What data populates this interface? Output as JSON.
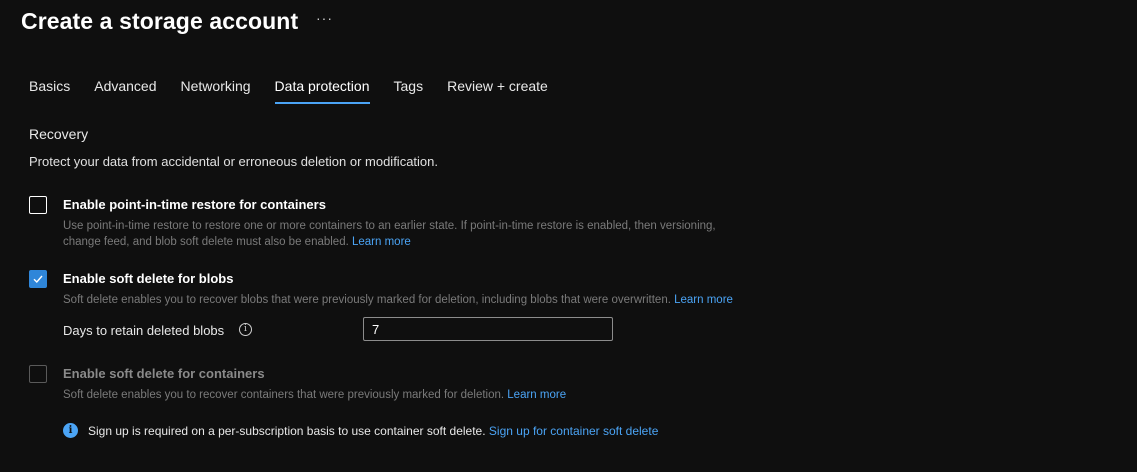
{
  "header": {
    "title": "Create a storage account",
    "more_label": "···"
  },
  "tabs": [
    {
      "label": "Basics"
    },
    {
      "label": "Advanced"
    },
    {
      "label": "Networking"
    },
    {
      "label": "Data protection",
      "active": true
    },
    {
      "label": "Tags"
    },
    {
      "label": "Review + create"
    }
  ],
  "recovery": {
    "title": "Recovery",
    "description": "Protect your data from accidental or erroneous deletion or modification.",
    "options": [
      {
        "label": "Enable point-in-time restore for containers",
        "help_line1": "Use point-in-time restore to restore one or more containers to an earlier state. If point-in-time restore is enabled, then versioning,",
        "help_line2": "change feed, and blob soft delete must also be enabled.",
        "link": "Learn more",
        "checked": false,
        "disabled": false
      },
      {
        "label": "Enable soft delete for blobs",
        "help": "Soft delete enables you to recover blobs that were previously marked for deletion, including blobs that were overwritten.",
        "link": "Learn more",
        "checked": true,
        "disabled": false
      },
      {
        "label": "Enable soft delete for containers",
        "help": "Soft delete enables you to recover containers that were previously marked for deletion.",
        "link": "Learn more",
        "checked": false,
        "disabled": true
      }
    ],
    "retain_days": {
      "label": "Days to retain deleted blobs",
      "value": "7"
    },
    "info_banner": {
      "text": "Sign up is required on a per-subscription basis to use container soft delete.",
      "link": "Sign up for container soft delete"
    }
  },
  "colors": {
    "background": "#0f0f0f",
    "accent": "#4ba4f5",
    "checkbox_checked": "#2f86d9"
  }
}
